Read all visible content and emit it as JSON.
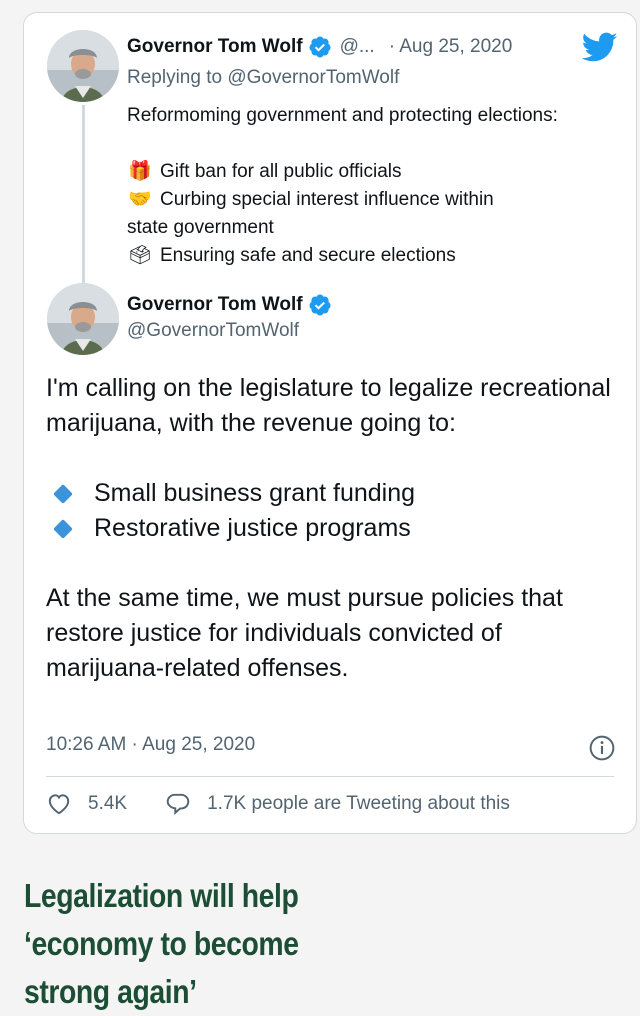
{
  "quoted_tweet": {
    "author_name": "Governor Tom Wolf",
    "handle_truncated": "@...",
    "date": "· Aug 25, 2020",
    "replying_to": "Replying to @GovernorTomWolf",
    "intro": "Reformoming government and protecting elections:",
    "items": [
      {
        "emoji": "🎁",
        "icon": "gift-emoji",
        "text": "Gift ban for all public officials"
      },
      {
        "emoji": "🤝",
        "icon": "handshake-emoji",
        "text": "Curbing special interest influence within"
      },
      {
        "emoji": "🗳",
        "icon": "ballot-box-emoji",
        "text": "Ensuring safe and secure elections"
      }
    ],
    "wrap_text": "state government"
  },
  "main_tweet": {
    "author_name": "Governor Tom Wolf",
    "handle": "@GovernorTomWolf",
    "paragraph1": "I'm calling on the legislature to legalize recreational marijuana, with the revenue going to:",
    "bullets": [
      "Small business grant funding",
      "Restorative justice programs"
    ],
    "paragraph2": "At the same time, we must pursue policies that restore justice for individuals convicted of marijuana-related offenses.",
    "timestamp": "10:26 AM · Aug 25, 2020",
    "likes": "5.4K",
    "conversation": "1.7K people are Tweeting about this"
  },
  "headline": "Legalization will help ‘economy to become strong again’",
  "colors": {
    "accent": "#1d9bf0",
    "headline": "#1c4d35",
    "bullet": "#3b94d9"
  }
}
